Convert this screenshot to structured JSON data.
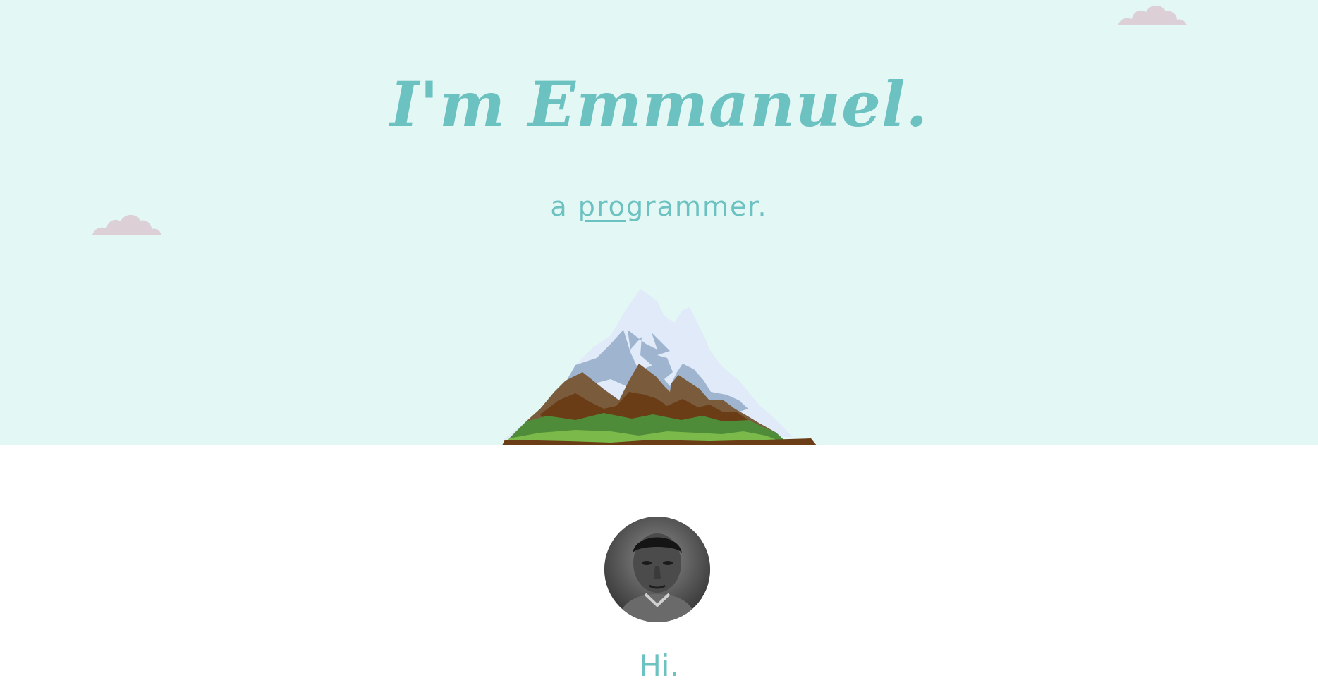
{
  "hero": {
    "title": "I'm Emmanuel.",
    "subtitle": {
      "prefix": "a ",
      "underlined": "pro",
      "suffix": "grammer."
    },
    "background_color": "#e3f7f5",
    "accent_color": "#6cc1c1",
    "cloud_color": "#dccfd6"
  },
  "about": {
    "greeting": "Hi.",
    "avatar_icon": "profile-photo"
  }
}
